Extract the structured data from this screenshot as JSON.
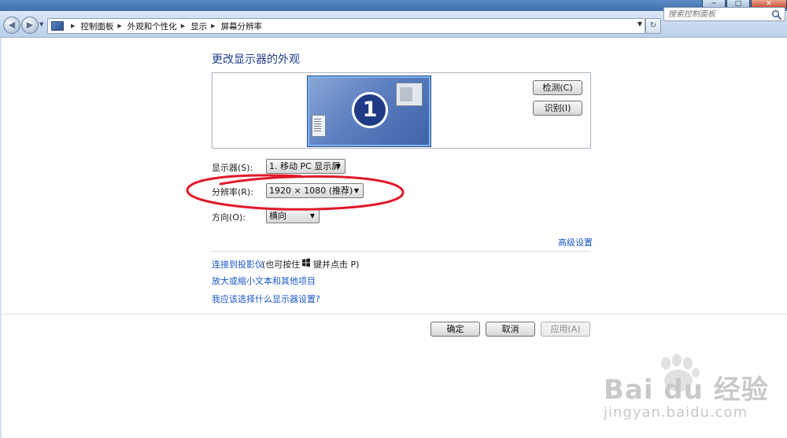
{
  "window": {
    "controls": {
      "minimize": "─",
      "maximize": "□",
      "close": "✕"
    }
  },
  "nav": {
    "back_glyph": "◀",
    "forward_glyph": "▶",
    "breadcrumb": [
      "控制面板",
      "外观和个性化",
      "显示",
      "屏幕分辨率"
    ],
    "refresh_glyph": "↻",
    "search_placeholder": "搜索控制面板"
  },
  "panel": {
    "title": "更改显示器的外观",
    "monitor_number": "1",
    "detect_button": "检测(C)",
    "identify_button": "识别(I)",
    "display_label": "显示器(S):",
    "display_value": "1. 移动 PC 显示屏",
    "resolution_label": "分辨率(R):",
    "resolution_value": "1920 × 1080 (推荐)",
    "orientation_label": "方向(O):",
    "orientation_value": "横向",
    "advanced_link": "高级设置",
    "projector_link": "连接到投影仪",
    "projector_note_a": "(也可按住",
    "projector_note_b": "键并点击 P)",
    "text_size_link": "放大或缩小文本和其他项目",
    "which_settings_link": "我应该选择什么显示器设置?"
  },
  "footer": {
    "ok": "确定",
    "cancel": "取消",
    "apply": "应用(A)"
  },
  "watermark": {
    "brand": "Bai du 经验",
    "site": "jingyan.baidu.com"
  },
  "colors": {
    "link": "#1a58c6",
    "title": "#1e3d8a",
    "annotation": "#e0192a"
  }
}
